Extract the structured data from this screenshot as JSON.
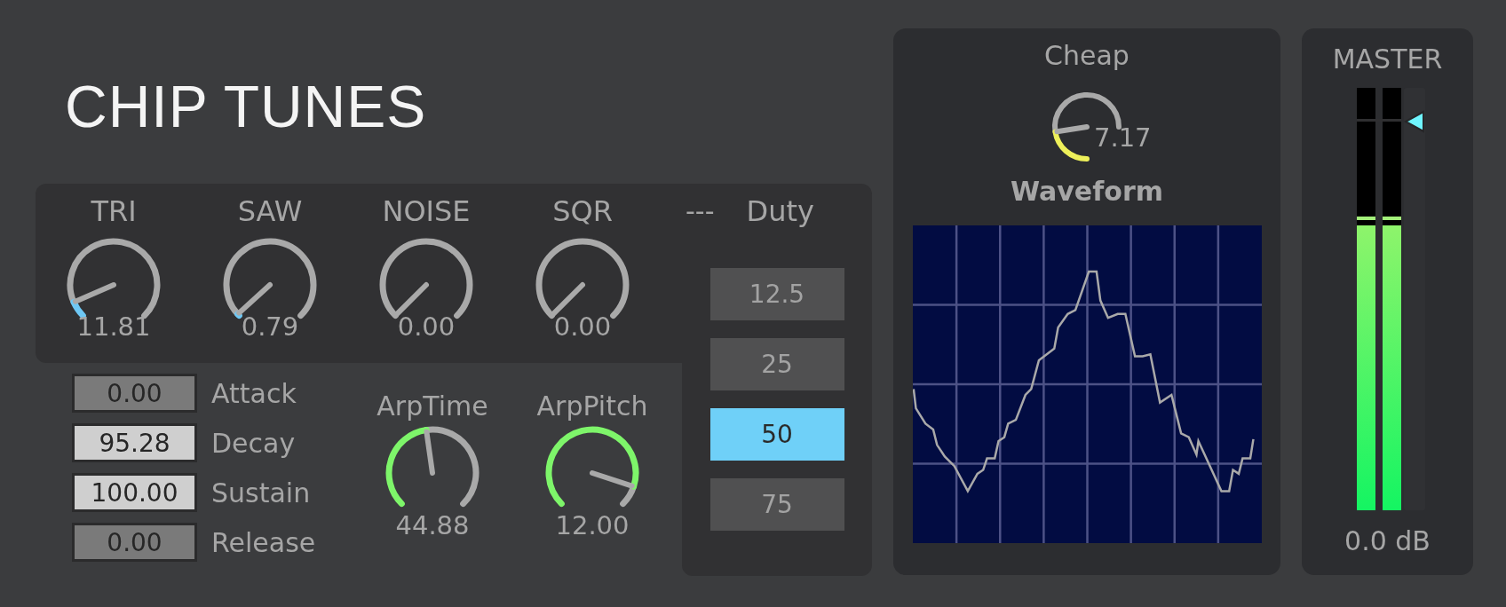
{
  "title": "CHIP TUNES",
  "oscillators": [
    {
      "label": "TRI",
      "value": "11.81",
      "level": 0.08
    },
    {
      "label": "SAW",
      "value": "0.79",
      "level": 0.01
    },
    {
      "label": "NOISE",
      "value": "0.00"
    },
    {
      "label": "SQR",
      "value": "0.00"
    }
  ],
  "duty": {
    "separator": "---",
    "label": "Duty",
    "options": [
      {
        "label": "12.5",
        "selected": false
      },
      {
        "label": "25",
        "selected": false
      },
      {
        "label": "50",
        "selected": true
      },
      {
        "label": "75",
        "selected": false
      }
    ]
  },
  "envelope": [
    {
      "label": "Attack",
      "value": "0.00",
      "active": false
    },
    {
      "label": "Decay",
      "value": "95.28",
      "active": true
    },
    {
      "label": "Sustain",
      "value": "100.00",
      "active": true
    },
    {
      "label": "Release",
      "value": "0.00",
      "active": false
    }
  ],
  "arp": [
    {
      "label": "ArpTime",
      "value": "44.88",
      "level": 0.47
    },
    {
      "label": "ArpPitch",
      "value": "12.00",
      "level": 0.9
    }
  ],
  "cheap": {
    "label": "Cheap",
    "value": "7.17",
    "level": 0.3
  },
  "waveform": {
    "label": "Waveform"
  },
  "master": {
    "label": "MASTER",
    "reading": "0.0 dB",
    "meters": [
      {
        "level": 0.675
      },
      {
        "level": 0.675
      }
    ],
    "fader": {
      "level": 0.92
    }
  }
}
